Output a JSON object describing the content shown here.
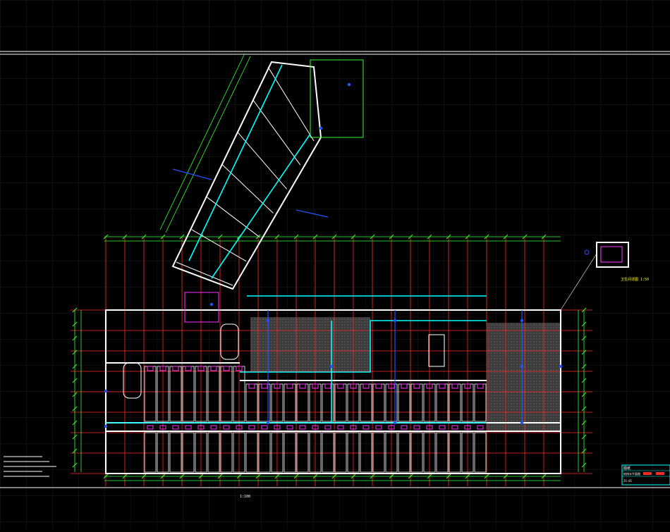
{
  "drawing": {
    "scale_note": "1:100",
    "title_block": {
      "label": "图纸",
      "rows": [
        "给排水平面图",
        "1:100",
        "JS-01"
      ]
    },
    "detail_label": "卫生间详图 1:50"
  },
  "colors": {
    "background": "#000000",
    "grid": "#1b1b1b",
    "frame": "#ffffff",
    "axis": "#ff2a2a",
    "wall": "#ffffff",
    "dimension": "#33ff33",
    "pipe_supply": "#00ffff",
    "pipe_drain": "#2255ff",
    "fixture": "#ff33ff",
    "annotation": "#ffff33",
    "hatch": "#666666"
  }
}
